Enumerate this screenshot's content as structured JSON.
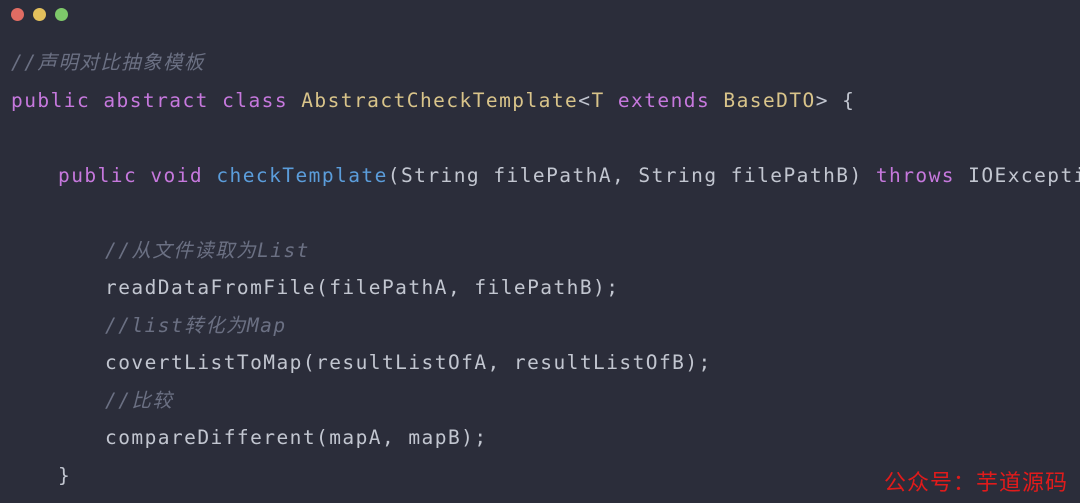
{
  "window": {
    "titlebar": {
      "buttons": [
        {
          "name": "close-button",
          "color": "#e06c63"
        },
        {
          "name": "minimize-button",
          "color": "#e3c05c"
        },
        {
          "name": "maximize-button",
          "color": "#7ec86a"
        }
      ]
    },
    "background_color": "#2b2d3a"
  },
  "editor": {
    "language": "java",
    "theme_colors": {
      "background": "#2b2d3a",
      "comment": "#6b7083",
      "keyword": "#c678dd",
      "type": "#d9c48a",
      "function": "#5b9ddb",
      "plain": "#c2c6d0"
    },
    "lines": [
      {
        "index": 1,
        "indent": 0,
        "tokens": [
          {
            "text": "//声明对比抽象模板",
            "kind": "comment"
          }
        ]
      },
      {
        "index": 2,
        "indent": 0,
        "tokens": [
          {
            "text": "public",
            "kind": "keyword"
          },
          {
            "text": " ",
            "kind": "plain"
          },
          {
            "text": "abstract",
            "kind": "keyword"
          },
          {
            "text": " ",
            "kind": "plain"
          },
          {
            "text": "class",
            "kind": "keyword"
          },
          {
            "text": " ",
            "kind": "plain"
          },
          {
            "text": "AbstractCheckTemplate",
            "kind": "type"
          },
          {
            "text": "<",
            "kind": "plain"
          },
          {
            "text": "T",
            "kind": "type"
          },
          {
            "text": " ",
            "kind": "plain"
          },
          {
            "text": "extends",
            "kind": "keyword"
          },
          {
            "text": " ",
            "kind": "plain"
          },
          {
            "text": "BaseDTO",
            "kind": "type"
          },
          {
            "text": "> {",
            "kind": "plain"
          }
        ]
      },
      {
        "index": 3,
        "indent": 0,
        "tokens": []
      },
      {
        "index": 4,
        "indent": 1,
        "tokens": [
          {
            "text": "public",
            "kind": "keyword"
          },
          {
            "text": " ",
            "kind": "plain"
          },
          {
            "text": "void",
            "kind": "keyword"
          },
          {
            "text": " ",
            "kind": "plain"
          },
          {
            "text": "checkTemplate",
            "kind": "function"
          },
          {
            "text": "(String filePathA, String filePathB) ",
            "kind": "plain"
          },
          {
            "text": "throws",
            "kind": "keyword"
          },
          {
            "text": " IOException {",
            "kind": "plain"
          }
        ]
      },
      {
        "index": 5,
        "indent": 0,
        "tokens": []
      },
      {
        "index": 6,
        "indent": 2,
        "tokens": [
          {
            "text": "//从文件读取为List",
            "kind": "comment"
          }
        ]
      },
      {
        "index": 7,
        "indent": 2,
        "tokens": [
          {
            "text": "readDataFromFile(filePathA, filePathB);",
            "kind": "plain"
          }
        ]
      },
      {
        "index": 8,
        "indent": 2,
        "tokens": [
          {
            "text": "//list转化为Map",
            "kind": "comment"
          }
        ]
      },
      {
        "index": 9,
        "indent": 2,
        "tokens": [
          {
            "text": "covertListToMap(resultListOfA, resultListOfB);",
            "kind": "plain"
          }
        ]
      },
      {
        "index": 10,
        "indent": 2,
        "tokens": [
          {
            "text": "//比较",
            "kind": "comment"
          }
        ]
      },
      {
        "index": 11,
        "indent": 2,
        "tokens": [
          {
            "text": "compareDifferent(mapA, mapB);",
            "kind": "plain"
          }
        ]
      },
      {
        "index": 12,
        "indent": 1,
        "tokens": [
          {
            "text": "}",
            "kind": "plain"
          }
        ]
      }
    ]
  },
  "watermark": {
    "text": "公众号：芋道源码",
    "color": "#e01b1b"
  }
}
